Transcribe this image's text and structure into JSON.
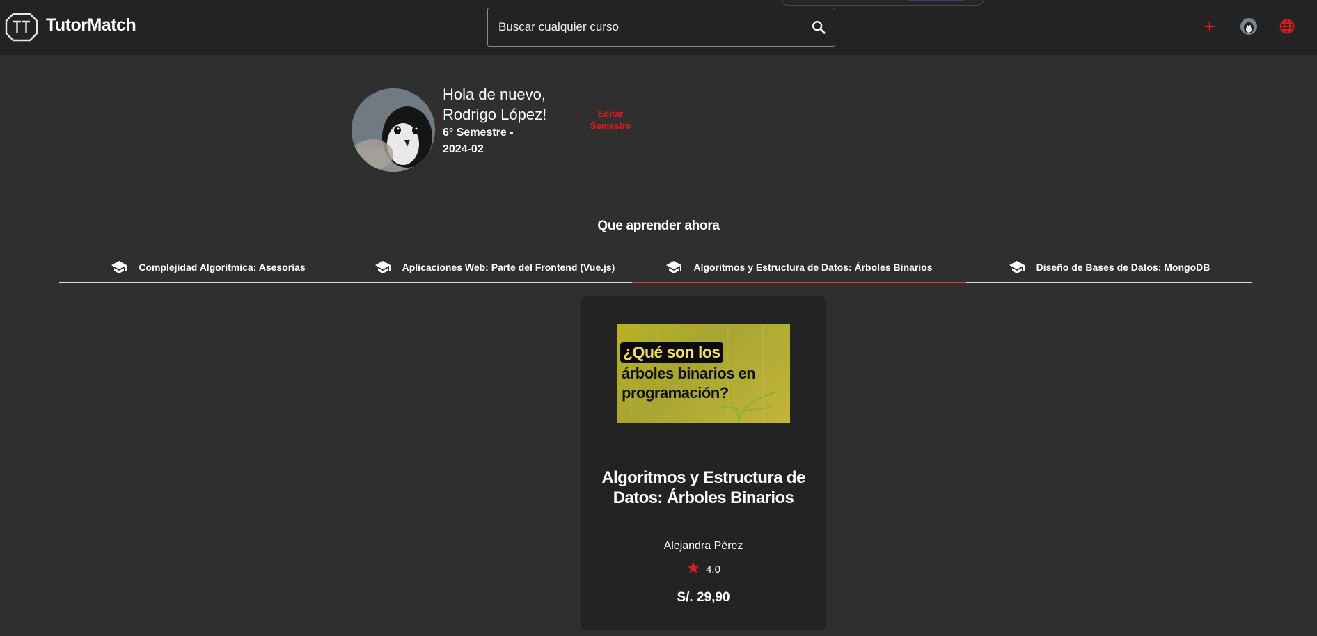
{
  "header": {
    "brand": "TutorMatch",
    "search": {
      "placeholder": "Buscar cualquier curso"
    },
    "icons": [
      "tutormatch-logo-icon",
      "search-icon",
      "add-icon",
      "user-avatar-icon",
      "language-globe-icon"
    ],
    "accent_color": "#e11b1b"
  },
  "profile": {
    "greeting": "Hola de nuevo, Rodrigo López!",
    "semester": "6° Semestre - 2024-02",
    "edit_semester_label": "Editar Semestre"
  },
  "section": {
    "title": "Que aprender ahora",
    "tabs": [
      {
        "label": "Complejidad Algorítmica: Asesorías",
        "icon": "graduation-cap-icon",
        "active": false
      },
      {
        "label": "Aplicaciones Web: Parte del Frontend (Vue.js)",
        "icon": "graduation-cap-icon",
        "active": false
      },
      {
        "label": "Algoritmos y Estructura de Datos: Árboles Binarios",
        "icon": "graduation-cap-icon",
        "active": true
      },
      {
        "label": "Diseño de Bases de Datos: MongoDB",
        "icon": "graduation-cap-icon",
        "active": false
      }
    ]
  },
  "course_card": {
    "thumbnail_lines": [
      "¿Qué son los",
      "árboles binarios en",
      "programación?"
    ],
    "title": "Algoritmos y Estructura de Datos: Árboles Binarios",
    "tutor": "Alejandra Pérez",
    "rating": "4.0",
    "price": "S/. 29,90",
    "star_color": "#e11b1b"
  }
}
